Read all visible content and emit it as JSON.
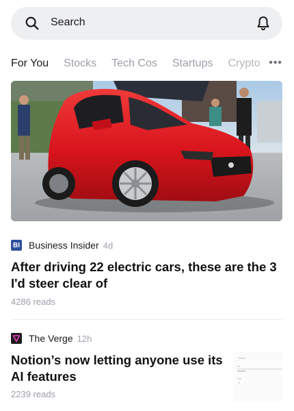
{
  "search": {
    "placeholder": "Search"
  },
  "tabs": [
    "For You",
    "Stocks",
    "Tech Cos",
    "Startups",
    "Crypto"
  ],
  "more": "•••",
  "articles": [
    {
      "source": "Business Insider",
      "source_badge": "BI",
      "age": "4d",
      "headline_line1": "After driving 22 electric cars, these are the 3",
      "headline_line2": "I'd steer clear of",
      "reads": "4286 reads"
    },
    {
      "source": "The Verge",
      "age": "12h",
      "headline_line1": "Notion’s now letting anyone use its",
      "headline_line2": "AI features",
      "reads": "2239 reads"
    }
  ],
  "colors": {
    "bi_badge": "#2f4f9c",
    "verge_badge": "#1c1c1c",
    "verge_accent": "#e83fc2",
    "car_red": "#d8141c"
  }
}
